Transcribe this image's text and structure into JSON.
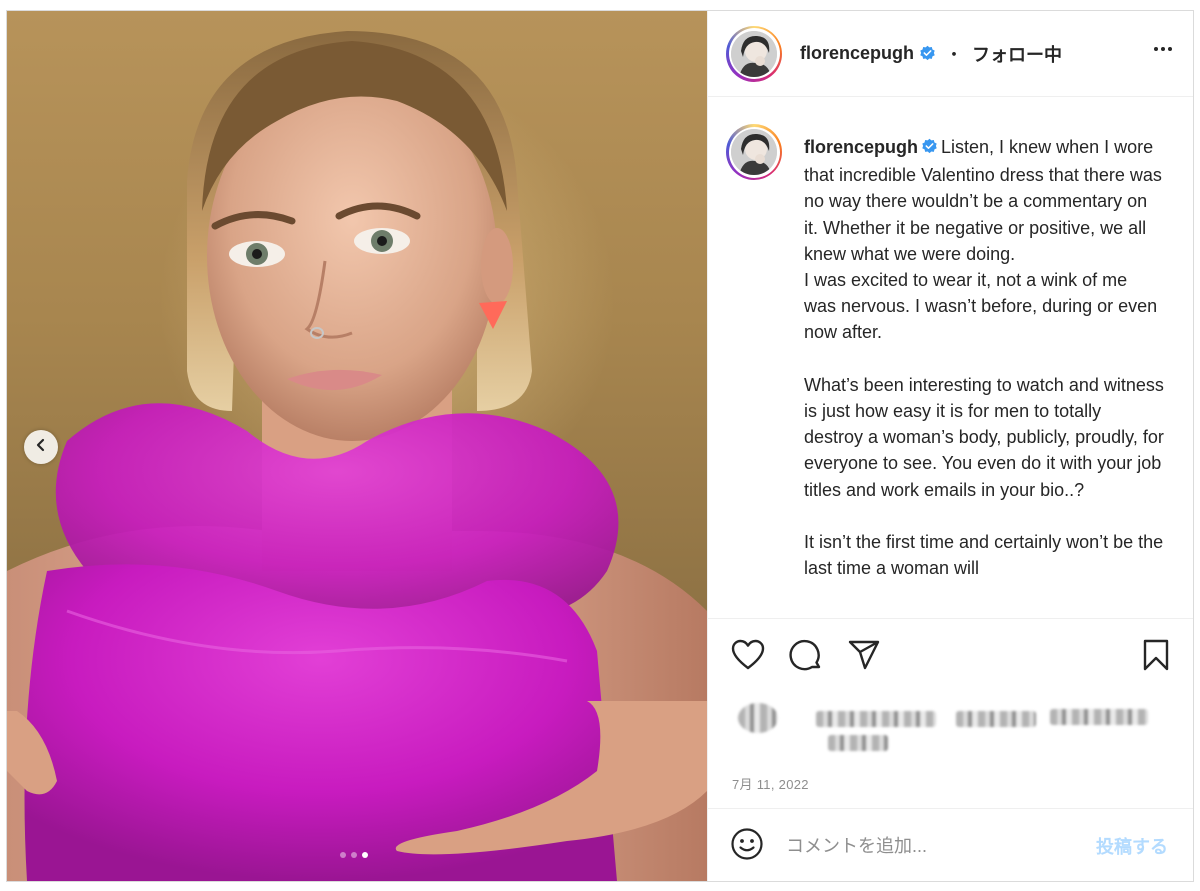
{
  "post": {
    "author": {
      "username": "florencepugh",
      "verified": true,
      "follow_separator": "・",
      "follow_status": "フォロー中"
    },
    "caption": {
      "username": "florencepugh",
      "text": "Listen, I knew when I wore that incredible Valentino dress that there was no way there wouldn’t be a commentary on it. Whether it be negative or positive, we all knew what we were doing.\nI was excited to wear it, not a wink of me was nervous. I wasn’t before, during or even now after.\n\nWhat’s been interesting to watch and witness is just how easy it is for men to totally destroy a woman’s body, publicly, proudly, for everyone to see. You even do it with your job titles and work emails in your bio..?\n\nIt isn’t the first time and certainly won’t be the last time a woman will"
    },
    "date": "7月 11, 2022",
    "carousel": {
      "slide_count": 3,
      "active_index": 2
    },
    "icons": {
      "like": "heart-icon",
      "comment": "comment-icon",
      "share": "share-icon",
      "save": "bookmark-icon",
      "emoji": "emoji-icon",
      "more": "more-icon",
      "prev": "chevron-left-icon"
    }
  },
  "comment_box": {
    "placeholder": "コメントを追加...",
    "value": "",
    "post_label": "投稿する"
  },
  "colors": {
    "verified": "#3897f0",
    "post_button_disabled": "#b3dbff",
    "dress": "#d21ec8"
  }
}
